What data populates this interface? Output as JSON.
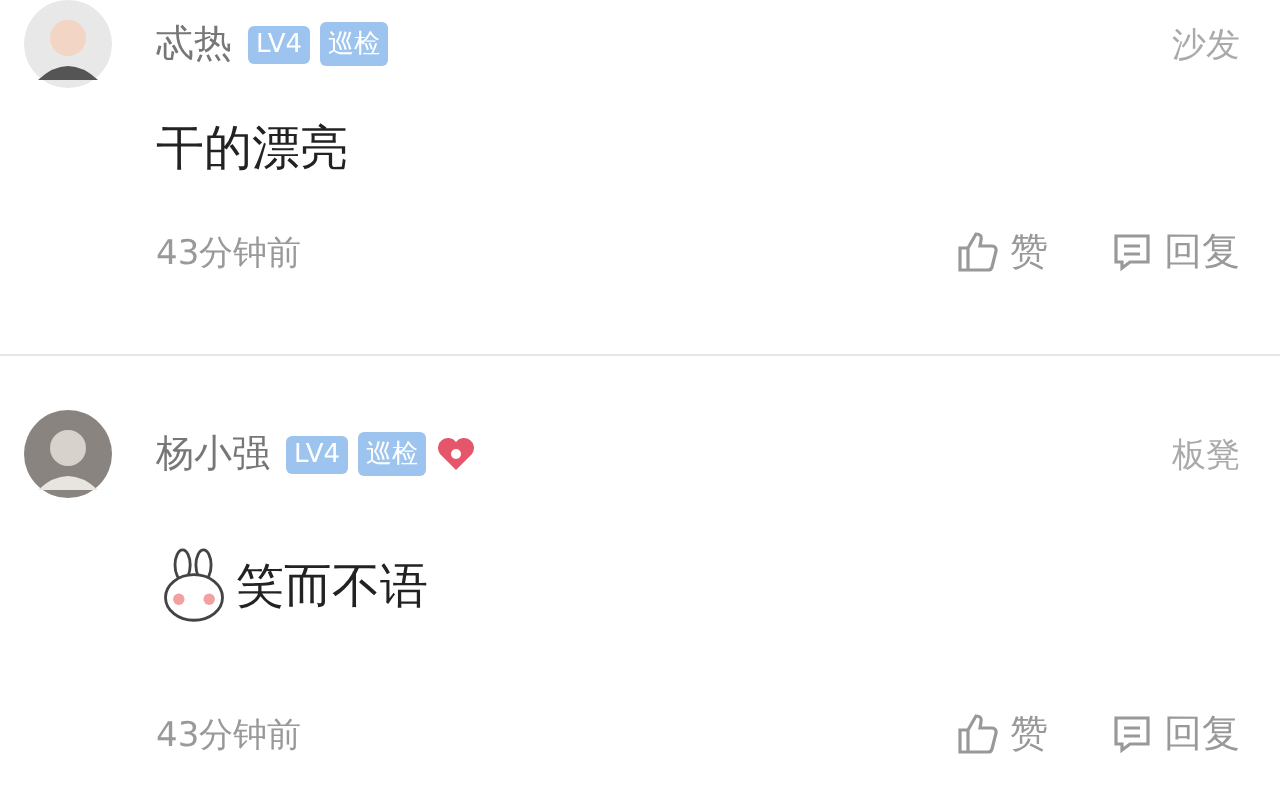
{
  "comments": [
    {
      "user": "忒热",
      "badges": [
        {
          "kind": "level",
          "label": "LV4"
        },
        {
          "kind": "role",
          "label": "巡检"
        }
      ],
      "floor": "沙发",
      "text": "干的漂亮",
      "emoji": false,
      "time": "43分钟前",
      "like": "赞",
      "reply": "回复"
    },
    {
      "user": "杨小强",
      "badges": [
        {
          "kind": "level",
          "label": "LV4"
        },
        {
          "kind": "role",
          "label": "巡检"
        },
        {
          "kind": "heart"
        }
      ],
      "floor": "板凳",
      "text": "笑而不语",
      "emoji": true,
      "time": "43分钟前",
      "like": "赞",
      "reply": "回复"
    }
  ]
}
